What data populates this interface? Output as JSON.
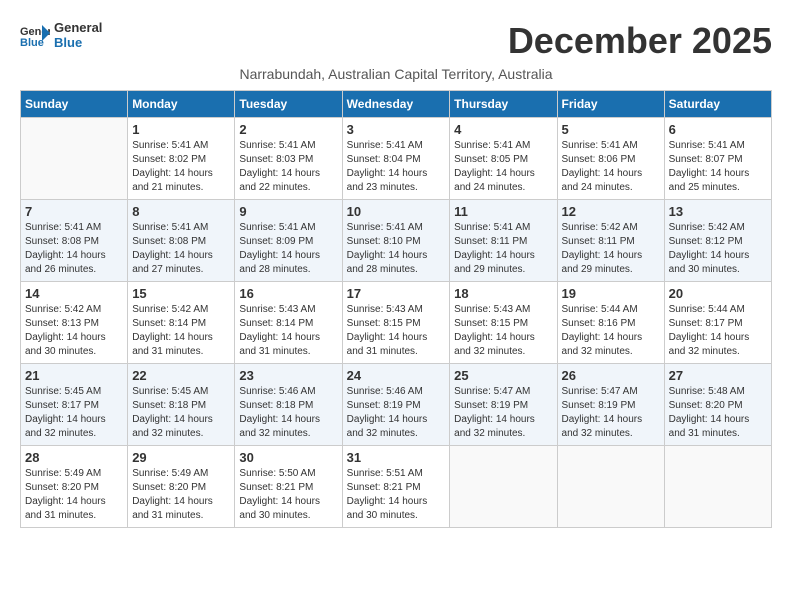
{
  "logo": {
    "line1": "General",
    "line2": "Blue"
  },
  "title": "December 2025",
  "location": "Narrabundah, Australian Capital Territory, Australia",
  "days_of_week": [
    "Sunday",
    "Monday",
    "Tuesday",
    "Wednesday",
    "Thursday",
    "Friday",
    "Saturday"
  ],
  "weeks": [
    [
      {
        "day": "",
        "sunrise": "",
        "sunset": "",
        "daylight": ""
      },
      {
        "day": "1",
        "sunrise": "Sunrise: 5:41 AM",
        "sunset": "Sunset: 8:02 PM",
        "daylight": "Daylight: 14 hours and 21 minutes."
      },
      {
        "day": "2",
        "sunrise": "Sunrise: 5:41 AM",
        "sunset": "Sunset: 8:03 PM",
        "daylight": "Daylight: 14 hours and 22 minutes."
      },
      {
        "day": "3",
        "sunrise": "Sunrise: 5:41 AM",
        "sunset": "Sunset: 8:04 PM",
        "daylight": "Daylight: 14 hours and 23 minutes."
      },
      {
        "day": "4",
        "sunrise": "Sunrise: 5:41 AM",
        "sunset": "Sunset: 8:05 PM",
        "daylight": "Daylight: 14 hours and 24 minutes."
      },
      {
        "day": "5",
        "sunrise": "Sunrise: 5:41 AM",
        "sunset": "Sunset: 8:06 PM",
        "daylight": "Daylight: 14 hours and 24 minutes."
      },
      {
        "day": "6",
        "sunrise": "Sunrise: 5:41 AM",
        "sunset": "Sunset: 8:07 PM",
        "daylight": "Daylight: 14 hours and 25 minutes."
      }
    ],
    [
      {
        "day": "7",
        "sunrise": "Sunrise: 5:41 AM",
        "sunset": "Sunset: 8:08 PM",
        "daylight": "Daylight: 14 hours and 26 minutes."
      },
      {
        "day": "8",
        "sunrise": "Sunrise: 5:41 AM",
        "sunset": "Sunset: 8:08 PM",
        "daylight": "Daylight: 14 hours and 27 minutes."
      },
      {
        "day": "9",
        "sunrise": "Sunrise: 5:41 AM",
        "sunset": "Sunset: 8:09 PM",
        "daylight": "Daylight: 14 hours and 28 minutes."
      },
      {
        "day": "10",
        "sunrise": "Sunrise: 5:41 AM",
        "sunset": "Sunset: 8:10 PM",
        "daylight": "Daylight: 14 hours and 28 minutes."
      },
      {
        "day": "11",
        "sunrise": "Sunrise: 5:41 AM",
        "sunset": "Sunset: 8:11 PM",
        "daylight": "Daylight: 14 hours and 29 minutes."
      },
      {
        "day": "12",
        "sunrise": "Sunrise: 5:42 AM",
        "sunset": "Sunset: 8:11 PM",
        "daylight": "Daylight: 14 hours and 29 minutes."
      },
      {
        "day": "13",
        "sunrise": "Sunrise: 5:42 AM",
        "sunset": "Sunset: 8:12 PM",
        "daylight": "Daylight: 14 hours and 30 minutes."
      }
    ],
    [
      {
        "day": "14",
        "sunrise": "Sunrise: 5:42 AM",
        "sunset": "Sunset: 8:13 PM",
        "daylight": "Daylight: 14 hours and 30 minutes."
      },
      {
        "day": "15",
        "sunrise": "Sunrise: 5:42 AM",
        "sunset": "Sunset: 8:14 PM",
        "daylight": "Daylight: 14 hours and 31 minutes."
      },
      {
        "day": "16",
        "sunrise": "Sunrise: 5:43 AM",
        "sunset": "Sunset: 8:14 PM",
        "daylight": "Daylight: 14 hours and 31 minutes."
      },
      {
        "day": "17",
        "sunrise": "Sunrise: 5:43 AM",
        "sunset": "Sunset: 8:15 PM",
        "daylight": "Daylight: 14 hours and 31 minutes."
      },
      {
        "day": "18",
        "sunrise": "Sunrise: 5:43 AM",
        "sunset": "Sunset: 8:15 PM",
        "daylight": "Daylight: 14 hours and 32 minutes."
      },
      {
        "day": "19",
        "sunrise": "Sunrise: 5:44 AM",
        "sunset": "Sunset: 8:16 PM",
        "daylight": "Daylight: 14 hours and 32 minutes."
      },
      {
        "day": "20",
        "sunrise": "Sunrise: 5:44 AM",
        "sunset": "Sunset: 8:17 PM",
        "daylight": "Daylight: 14 hours and 32 minutes."
      }
    ],
    [
      {
        "day": "21",
        "sunrise": "Sunrise: 5:45 AM",
        "sunset": "Sunset: 8:17 PM",
        "daylight": "Daylight: 14 hours and 32 minutes."
      },
      {
        "day": "22",
        "sunrise": "Sunrise: 5:45 AM",
        "sunset": "Sunset: 8:18 PM",
        "daylight": "Daylight: 14 hours and 32 minutes."
      },
      {
        "day": "23",
        "sunrise": "Sunrise: 5:46 AM",
        "sunset": "Sunset: 8:18 PM",
        "daylight": "Daylight: 14 hours and 32 minutes."
      },
      {
        "day": "24",
        "sunrise": "Sunrise: 5:46 AM",
        "sunset": "Sunset: 8:19 PM",
        "daylight": "Daylight: 14 hours and 32 minutes."
      },
      {
        "day": "25",
        "sunrise": "Sunrise: 5:47 AM",
        "sunset": "Sunset: 8:19 PM",
        "daylight": "Daylight: 14 hours and 32 minutes."
      },
      {
        "day": "26",
        "sunrise": "Sunrise: 5:47 AM",
        "sunset": "Sunset: 8:19 PM",
        "daylight": "Daylight: 14 hours and 32 minutes."
      },
      {
        "day": "27",
        "sunrise": "Sunrise: 5:48 AM",
        "sunset": "Sunset: 8:20 PM",
        "daylight": "Daylight: 14 hours and 31 minutes."
      }
    ],
    [
      {
        "day": "28",
        "sunrise": "Sunrise: 5:49 AM",
        "sunset": "Sunset: 8:20 PM",
        "daylight": "Daylight: 14 hours and 31 minutes."
      },
      {
        "day": "29",
        "sunrise": "Sunrise: 5:49 AM",
        "sunset": "Sunset: 8:20 PM",
        "daylight": "Daylight: 14 hours and 31 minutes."
      },
      {
        "day": "30",
        "sunrise": "Sunrise: 5:50 AM",
        "sunset": "Sunset: 8:21 PM",
        "daylight": "Daylight: 14 hours and 30 minutes."
      },
      {
        "day": "31",
        "sunrise": "Sunrise: 5:51 AM",
        "sunset": "Sunset: 8:21 PM",
        "daylight": "Daylight: 14 hours and 30 minutes."
      },
      {
        "day": "",
        "sunrise": "",
        "sunset": "",
        "daylight": ""
      },
      {
        "day": "",
        "sunrise": "",
        "sunset": "",
        "daylight": ""
      },
      {
        "day": "",
        "sunrise": "",
        "sunset": "",
        "daylight": ""
      }
    ]
  ]
}
